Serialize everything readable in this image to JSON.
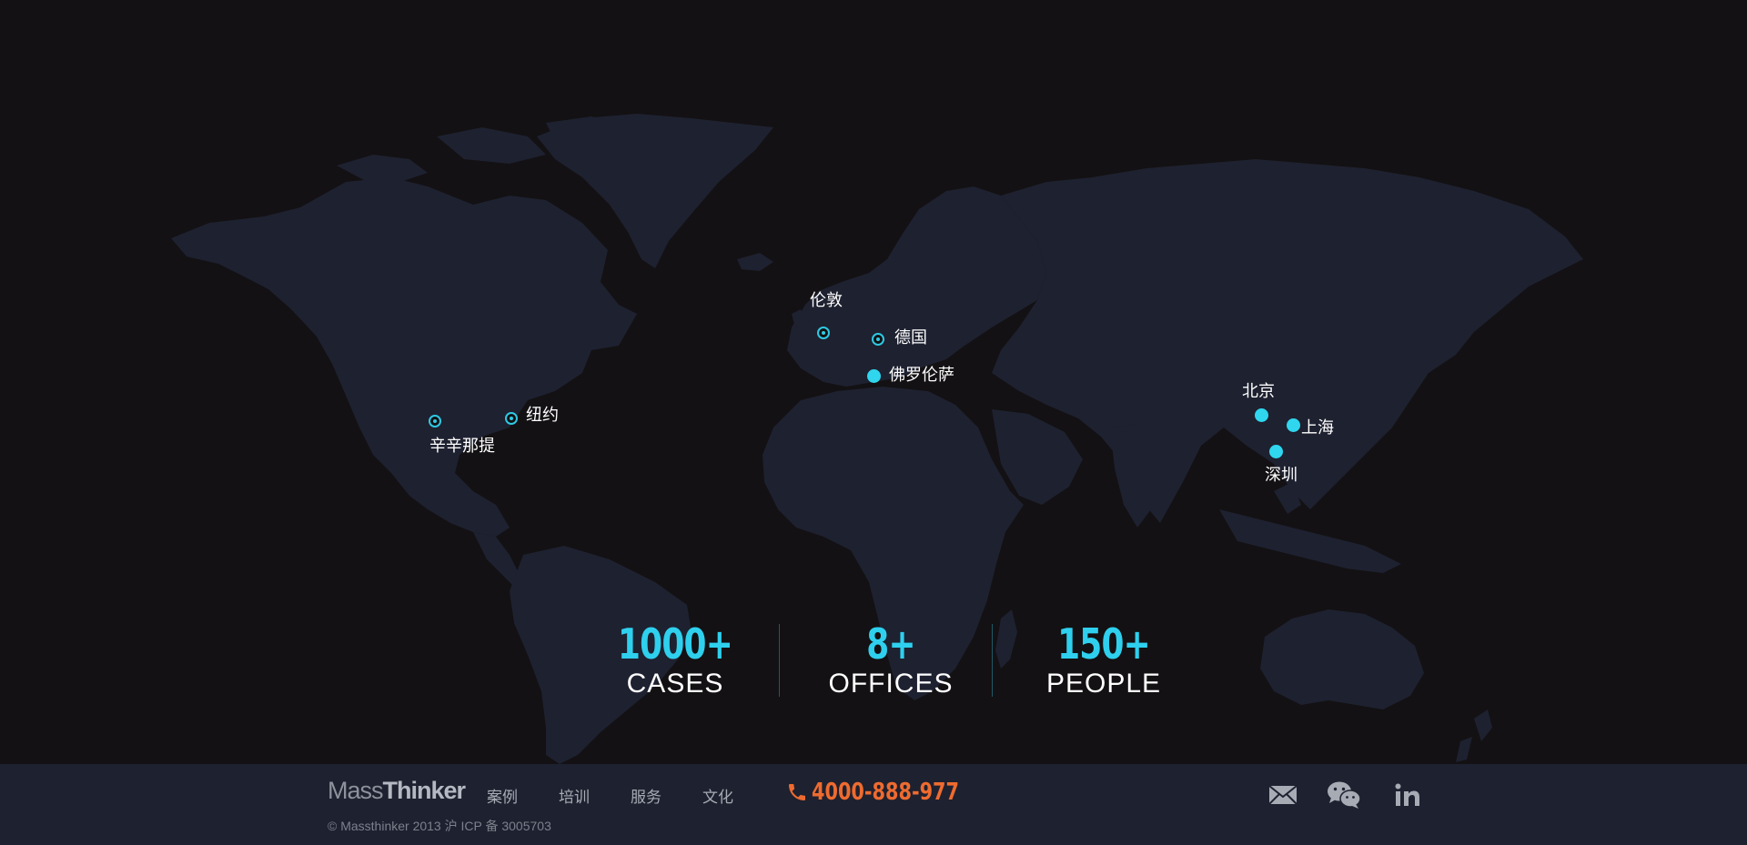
{
  "map": {
    "cities": [
      {
        "id": "london",
        "name": "伦敦",
        "style": "ring"
      },
      {
        "id": "germany",
        "name": "德国",
        "style": "ring"
      },
      {
        "id": "florence",
        "name": "佛罗伦萨",
        "style": "solid"
      },
      {
        "id": "cincinnati",
        "name": "辛辛那提",
        "style": "ring"
      },
      {
        "id": "new-york",
        "name": "纽约",
        "style": "ring"
      },
      {
        "id": "beijing",
        "name": "北京",
        "style": "solid"
      },
      {
        "id": "shanghai",
        "name": "上海",
        "style": "solid"
      },
      {
        "id": "shenzhen",
        "name": "深圳",
        "style": "solid"
      }
    ]
  },
  "stats": [
    {
      "value": "1000+",
      "label": "CASES"
    },
    {
      "value": "8+",
      "label": "OFFICES"
    },
    {
      "value": "150+",
      "label": "PEOPLE"
    }
  ],
  "footer": {
    "logo_light": "Mass",
    "logo_bold": "Thinker",
    "nav": [
      "案例",
      "培训",
      "服务",
      "文化"
    ],
    "phone": "4000-888-977",
    "copyright": "© Massthinker 2013 沪 ICP 备 3005703",
    "social_icons": [
      "mail-icon",
      "wechat-icon",
      "linkedin-icon"
    ]
  },
  "colors": {
    "background": "#131113",
    "land": "#1e2130",
    "accent": "#2ed0ee",
    "phone": "#ee6b2f",
    "footer": "#1e2130"
  }
}
